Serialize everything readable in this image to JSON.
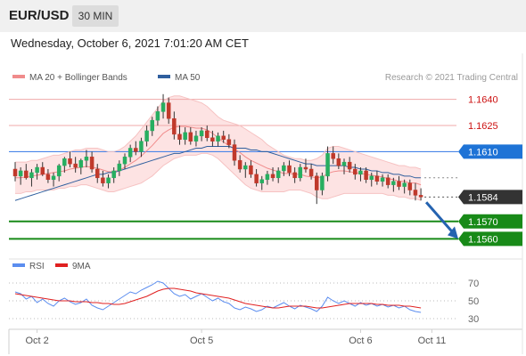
{
  "header": {
    "pair": "EUR/USD",
    "timeframe": "30 MIN",
    "timestamp": "Wednesday, October 6, 2021 7:01:20 AM CET"
  },
  "colors": {
    "bollinger": "#f08b8b",
    "bollinger_fill": "#fde3e3",
    "ma50": "#2f5f9e",
    "resistance": "#f0a8a8",
    "resistance_text": "#cc1111",
    "pivot_line": "#4a86e8",
    "pivot_tag": "#1e73d6",
    "support": "#188a18",
    "current_tag": "#333333",
    "candle_up": "#27ae60",
    "candle_down": "#c0392b",
    "arrow": "#2563b0",
    "rsi": "#5b8def",
    "rsi_ma": "#e02020"
  },
  "chart_data": [
    {
      "type": "candlestick",
      "title": "EUR/USD",
      "legend": [
        {
          "name": "MA 20 + Bollinger Bands",
          "color": "#f08b8b"
        },
        {
          "name": "MA 50",
          "color": "#2f5f9e"
        }
      ],
      "legend_position": "top-left",
      "credit": "Research © 2021 Trading Central",
      "ylim": [
        1.1552,
        1.1648
      ],
      "x_ticks": [
        {
          "label": "Oct 2",
          "index": 4
        },
        {
          "label": "Oct 5",
          "index": 34
        },
        {
          "label": "Oct 6",
          "index": 63
        },
        {
          "label": "Oct 11",
          "index": 76
        }
      ],
      "candles_count": 75,
      "ohlc": [
        [
          1.16,
          1.1604,
          1.1593,
          1.1596
        ],
        [
          1.1596,
          1.1601,
          1.1591,
          1.1599
        ],
        [
          1.1599,
          1.1603,
          1.1594,
          1.1595
        ],
        [
          1.1595,
          1.16,
          1.159,
          1.1598
        ],
        [
          1.1598,
          1.1603,
          1.1594,
          1.1601
        ],
        [
          1.1601,
          1.1604,
          1.1596,
          1.1597
        ],
        [
          1.1597,
          1.16,
          1.1592,
          1.1594
        ],
        [
          1.1594,
          1.1598,
          1.159,
          1.1596
        ],
        [
          1.1596,
          1.1603,
          1.1593,
          1.1602
        ],
        [
          1.1602,
          1.1607,
          1.1598,
          1.1606
        ],
        [
          1.1606,
          1.161,
          1.1601,
          1.1603
        ],
        [
          1.1603,
          1.1607,
          1.1598,
          1.1601
        ],
        [
          1.1601,
          1.1606,
          1.1597,
          1.1605
        ],
        [
          1.1605,
          1.1611,
          1.1601,
          1.1607
        ],
        [
          1.1607,
          1.161,
          1.1598,
          1.16
        ],
        [
          1.16,
          1.1603,
          1.1592,
          1.1595
        ],
        [
          1.1595,
          1.1599,
          1.159,
          1.1592
        ],
        [
          1.1592,
          1.1597,
          1.1589,
          1.1595
        ],
        [
          1.1595,
          1.1601,
          1.1592,
          1.1599
        ],
        [
          1.1599,
          1.1605,
          1.1596,
          1.1603
        ],
        [
          1.1603,
          1.1609,
          1.16,
          1.1607
        ],
        [
          1.1607,
          1.1614,
          1.1604,
          1.1612
        ],
        [
          1.1612,
          1.1616,
          1.1608,
          1.161
        ],
        [
          1.161,
          1.1618,
          1.1607,
          1.1616
        ],
        [
          1.1616,
          1.1625,
          1.1613,
          1.1622
        ],
        [
          1.1622,
          1.163,
          1.1619,
          1.1628
        ],
        [
          1.1628,
          1.1636,
          1.1625,
          1.1633
        ],
        [
          1.1633,
          1.1643,
          1.1629,
          1.1638
        ],
        [
          1.1638,
          1.1641,
          1.1626,
          1.1629
        ],
        [
          1.1629,
          1.1633,
          1.1617,
          1.162
        ],
        [
          1.162,
          1.1625,
          1.1614,
          1.1617
        ],
        [
          1.1617,
          1.1624,
          1.1614,
          1.1621
        ],
        [
          1.1621,
          1.1624,
          1.1614,
          1.1616
        ],
        [
          1.1616,
          1.1622,
          1.1613,
          1.1619
        ],
        [
          1.1619,
          1.1624,
          1.1616,
          1.1622
        ],
        [
          1.1622,
          1.1625,
          1.1616,
          1.1618
        ],
        [
          1.1618,
          1.1622,
          1.1613,
          1.1616
        ],
        [
          1.1616,
          1.1621,
          1.1613,
          1.1619
        ],
        [
          1.1619,
          1.1622,
          1.1615,
          1.1617
        ],
        [
          1.1617,
          1.162,
          1.1612,
          1.1614
        ],
        [
          1.1614,
          1.1617,
          1.1602,
          1.1605
        ],
        [
          1.1605,
          1.1608,
          1.1598,
          1.16
        ],
        [
          1.16,
          1.1604,
          1.1595,
          1.1602
        ],
        [
          1.1602,
          1.1605,
          1.1595,
          1.1597
        ],
        [
          1.1597,
          1.16,
          1.159,
          1.1592
        ],
        [
          1.1592,
          1.1596,
          1.1588,
          1.1594
        ],
        [
          1.1594,
          1.1599,
          1.1591,
          1.1597
        ],
        [
          1.1597,
          1.1601,
          1.1593,
          1.1595
        ],
        [
          1.1595,
          1.1601,
          1.1592,
          1.1599
        ],
        [
          1.1599,
          1.1604,
          1.1596,
          1.1602
        ],
        [
          1.1602,
          1.1605,
          1.1596,
          1.1598
        ],
        [
          1.1598,
          1.1601,
          1.1592,
          1.1595
        ],
        [
          1.1595,
          1.1603,
          1.1593,
          1.1601
        ],
        [
          1.1601,
          1.1606,
          1.1598,
          1.16
        ],
        [
          1.16,
          1.1603,
          1.1594,
          1.1596
        ],
        [
          1.1596,
          1.1598,
          1.158,
          1.1588
        ],
        [
          1.1588,
          1.1598,
          1.1585,
          1.1596
        ],
        [
          1.1596,
          1.1613,
          1.1593,
          1.1609
        ],
        [
          1.1609,
          1.1613,
          1.1603,
          1.1606
        ],
        [
          1.1606,
          1.1609,
          1.16,
          1.1602
        ],
        [
          1.1602,
          1.1606,
          1.1597,
          1.1604
        ],
        [
          1.1604,
          1.1607,
          1.1598,
          1.16
        ],
        [
          1.16,
          1.1603,
          1.1594,
          1.1597
        ],
        [
          1.1597,
          1.1601,
          1.1593,
          1.1599
        ],
        [
          1.1599,
          1.1601,
          1.1592,
          1.1594
        ],
        [
          1.1594,
          1.1598,
          1.159,
          1.1596
        ],
        [
          1.1596,
          1.1599,
          1.1591,
          1.1593
        ],
        [
          1.1593,
          1.1597,
          1.159,
          1.1595
        ],
        [
          1.1595,
          1.1597,
          1.1589,
          1.1591
        ],
        [
          1.1591,
          1.1595,
          1.1587,
          1.1593
        ],
        [
          1.1593,
          1.1596,
          1.1588,
          1.159
        ],
        [
          1.159,
          1.1594,
          1.1586,
          1.1592
        ],
        [
          1.1592,
          1.1594,
          1.1585,
          1.1588
        ],
        [
          1.1588,
          1.1592,
          1.1582,
          1.1585
        ],
        [
          1.1585,
          1.1589,
          1.1582,
          1.1584
        ]
      ],
      "ma50": [
        1.1582,
        1.1583,
        1.1584,
        1.1585,
        1.1586,
        1.1587,
        1.1588,
        1.1589,
        1.159,
        1.1591,
        1.1592,
        1.1593,
        1.1594,
        1.1595,
        1.1596,
        1.1597,
        1.1597,
        1.1598,
        1.1598,
        1.1599,
        1.16,
        1.1601,
        1.1602,
        1.1603,
        1.1604,
        1.1605,
        1.1606,
        1.1607,
        1.1608,
        1.1609,
        1.1609,
        1.161,
        1.1611,
        1.1612,
        1.1612,
        1.1613,
        1.1613,
        1.1613,
        1.1613,
        1.1613,
        1.1612,
        1.1612,
        1.1612,
        1.1611,
        1.1611,
        1.161,
        1.161,
        1.1609,
        1.1608,
        1.1607,
        1.1606,
        1.1605,
        1.1604,
        1.1603,
        1.1603,
        1.1602,
        1.1602,
        1.1602,
        1.1602,
        1.1602,
        1.1602,
        1.1601,
        1.1601,
        1.16,
        1.16,
        1.1599,
        1.1599,
        1.1598,
        1.1598,
        1.1597,
        1.1597,
        1.1596,
        1.1596,
        1.1595,
        1.1595
      ],
      "bollinger_upper": [
        1.1604,
        1.1604,
        1.1604,
        1.1605,
        1.1605,
        1.1606,
        1.1607,
        1.1608,
        1.1608,
        1.1609,
        1.161,
        1.1611,
        1.1611,
        1.1612,
        1.1612,
        1.1612,
        1.1611,
        1.161,
        1.161,
        1.1611,
        1.1613,
        1.1616,
        1.1619,
        1.1623,
        1.1627,
        1.1631,
        1.1635,
        1.1639,
        1.1641,
        1.1642,
        1.1642,
        1.1641,
        1.164,
        1.1639,
        1.1638,
        1.1636,
        1.1633,
        1.163,
        1.1628,
        1.1627,
        1.1626,
        1.1625,
        1.1623,
        1.1621,
        1.1619,
        1.1617,
        1.1614,
        1.1612,
        1.161,
        1.1608,
        1.1607,
        1.1606,
        1.1606,
        1.1605,
        1.1605,
        1.1606,
        1.1608,
        1.1612,
        1.1613,
        1.1613,
        1.1612,
        1.1611,
        1.161,
        1.1609,
        1.1608,
        1.1607,
        1.1606,
        1.1605,
        1.1604,
        1.1603,
        1.1602,
        1.1602,
        1.1601,
        1.1601,
        1.16
      ],
      "bollinger_lower": [
        1.1586,
        1.1586,
        1.1587,
        1.1587,
        1.1588,
        1.1588,
        1.1588,
        1.1588,
        1.1589,
        1.1589,
        1.159,
        1.159,
        1.1591,
        1.1591,
        1.159,
        1.1589,
        1.1588,
        1.1587,
        1.1587,
        1.1588,
        1.1589,
        1.159,
        1.1591,
        1.1592,
        1.1594,
        1.1596,
        1.1599,
        1.1602,
        1.1604,
        1.1606,
        1.1607,
        1.1608,
        1.1608,
        1.1608,
        1.1609,
        1.1609,
        1.1608,
        1.1606,
        1.1603,
        1.16,
        1.1597,
        1.1594,
        1.1591,
        1.1589,
        1.1588,
        1.1587,
        1.1587,
        1.1587,
        1.1587,
        1.1587,
        1.1588,
        1.1588,
        1.1588,
        1.1587,
        1.1586,
        1.1584,
        1.1583,
        1.1583,
        1.1584,
        1.1585,
        1.1586,
        1.1586,
        1.1586,
        1.1586,
        1.1586,
        1.1586,
        1.1586,
        1.1586,
        1.1585,
        1.1585,
        1.1584,
        1.1584,
        1.1583,
        1.1583,
        1.1582
      ],
      "levels": [
        {
          "label": "1.1640",
          "value": 1.164,
          "kind": "resistance"
        },
        {
          "label": "1.1625",
          "value": 1.1625,
          "kind": "resistance"
        },
        {
          "label": "1.1610",
          "value": 1.161,
          "kind": "pivot"
        },
        {
          "label": "1.1584",
          "value": 1.1584,
          "kind": "current"
        },
        {
          "label": "1.1570",
          "value": 1.157,
          "kind": "support"
        },
        {
          "label": "1.1560",
          "value": 1.156,
          "kind": "support"
        }
      ],
      "forecast_arrow": {
        "from": 1.1582,
        "to": 1.156
      }
    },
    {
      "type": "line",
      "legend": [
        {
          "name": "RSI",
          "color": "#5b8def"
        },
        {
          "name": "9MA",
          "color": "#e02020"
        }
      ],
      "legend_position": "top-left",
      "ylim": [
        22,
        78
      ],
      "y_ticks": [
        70,
        50,
        30
      ],
      "gridlines": [
        70,
        50,
        30
      ],
      "rsi": [
        60,
        58,
        52,
        55,
        48,
        52,
        47,
        44,
        50,
        53,
        49,
        46,
        48,
        52,
        45,
        42,
        40,
        44,
        48,
        52,
        56,
        60,
        58,
        62,
        65,
        68,
        72,
        70,
        64,
        58,
        55,
        57,
        52,
        55,
        58,
        54,
        50,
        53,
        49,
        47,
        42,
        40,
        43,
        41,
        38,
        40,
        44,
        42,
        45,
        48,
        44,
        41,
        45,
        43,
        41,
        38,
        44,
        54,
        50,
        47,
        50,
        47,
        44,
        48,
        45,
        47,
        44,
        46,
        43,
        45,
        42,
        44,
        40,
        38,
        37
      ],
      "rsi_ma": [
        58,
        57,
        56,
        55,
        54,
        53,
        52,
        51,
        50,
        50,
        50,
        49,
        49,
        49,
        48,
        48,
        47,
        47,
        46,
        46,
        47,
        49,
        51,
        53,
        55,
        58,
        61,
        63,
        64,
        64,
        63,
        62,
        61,
        59,
        58,
        57,
        56,
        55,
        54,
        53,
        51,
        49,
        47,
        46,
        45,
        44,
        43,
        42,
        42,
        43,
        44,
        44,
        44,
        44,
        43,
        42,
        42,
        43,
        44,
        45,
        46,
        47,
        47,
        47,
        47,
        47,
        46,
        46,
        45,
        45,
        45,
        44,
        44,
        43,
        42
      ]
    }
  ]
}
